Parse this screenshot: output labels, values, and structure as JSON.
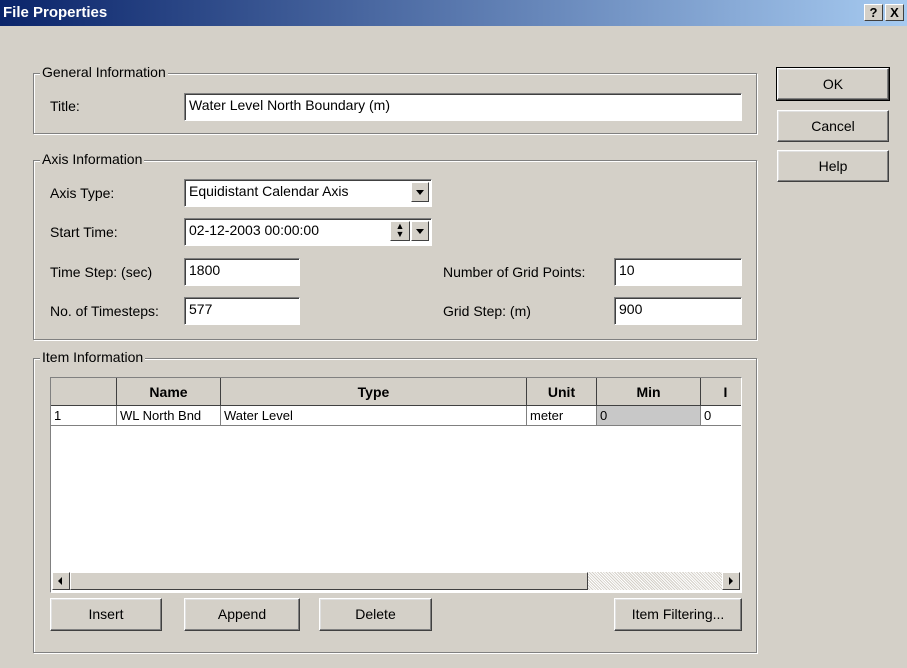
{
  "window": {
    "title": "File Properties",
    "help_btn": "?",
    "close_btn": "X"
  },
  "buttons": {
    "ok": "OK",
    "cancel": "Cancel",
    "help": "Help"
  },
  "general": {
    "legend": "General Information",
    "title_label": "Title:",
    "title_value": "Water Level North Boundary (m)"
  },
  "axis": {
    "legend": "Axis Information",
    "axis_type_label": "Axis Type:",
    "axis_type_value": "Equidistant Calendar Axis",
    "start_time_label": "Start Time:",
    "start_time_value": "02-12-2003 00:00:00",
    "time_step_label": "Time Step: (sec)",
    "time_step_value": "1800",
    "timesteps_label": "No. of Timesteps:",
    "timesteps_value": "577",
    "grid_points_label": "Number of Grid Points:",
    "grid_points_value": "10",
    "grid_step_label": "Grid Step: (m)",
    "grid_step_value": "900"
  },
  "items": {
    "legend": "Item Information",
    "columns": [
      "",
      "Name",
      "Type",
      "Unit",
      "Min",
      "I"
    ],
    "rows": [
      {
        "index": "1",
        "name": "WL North Bnd",
        "type": "Water Level",
        "unit": "meter",
        "min": "0",
        "max": "0"
      }
    ],
    "insert": "Insert",
    "append": "Append",
    "delete": "Delete",
    "filtering": "Item Filtering..."
  }
}
